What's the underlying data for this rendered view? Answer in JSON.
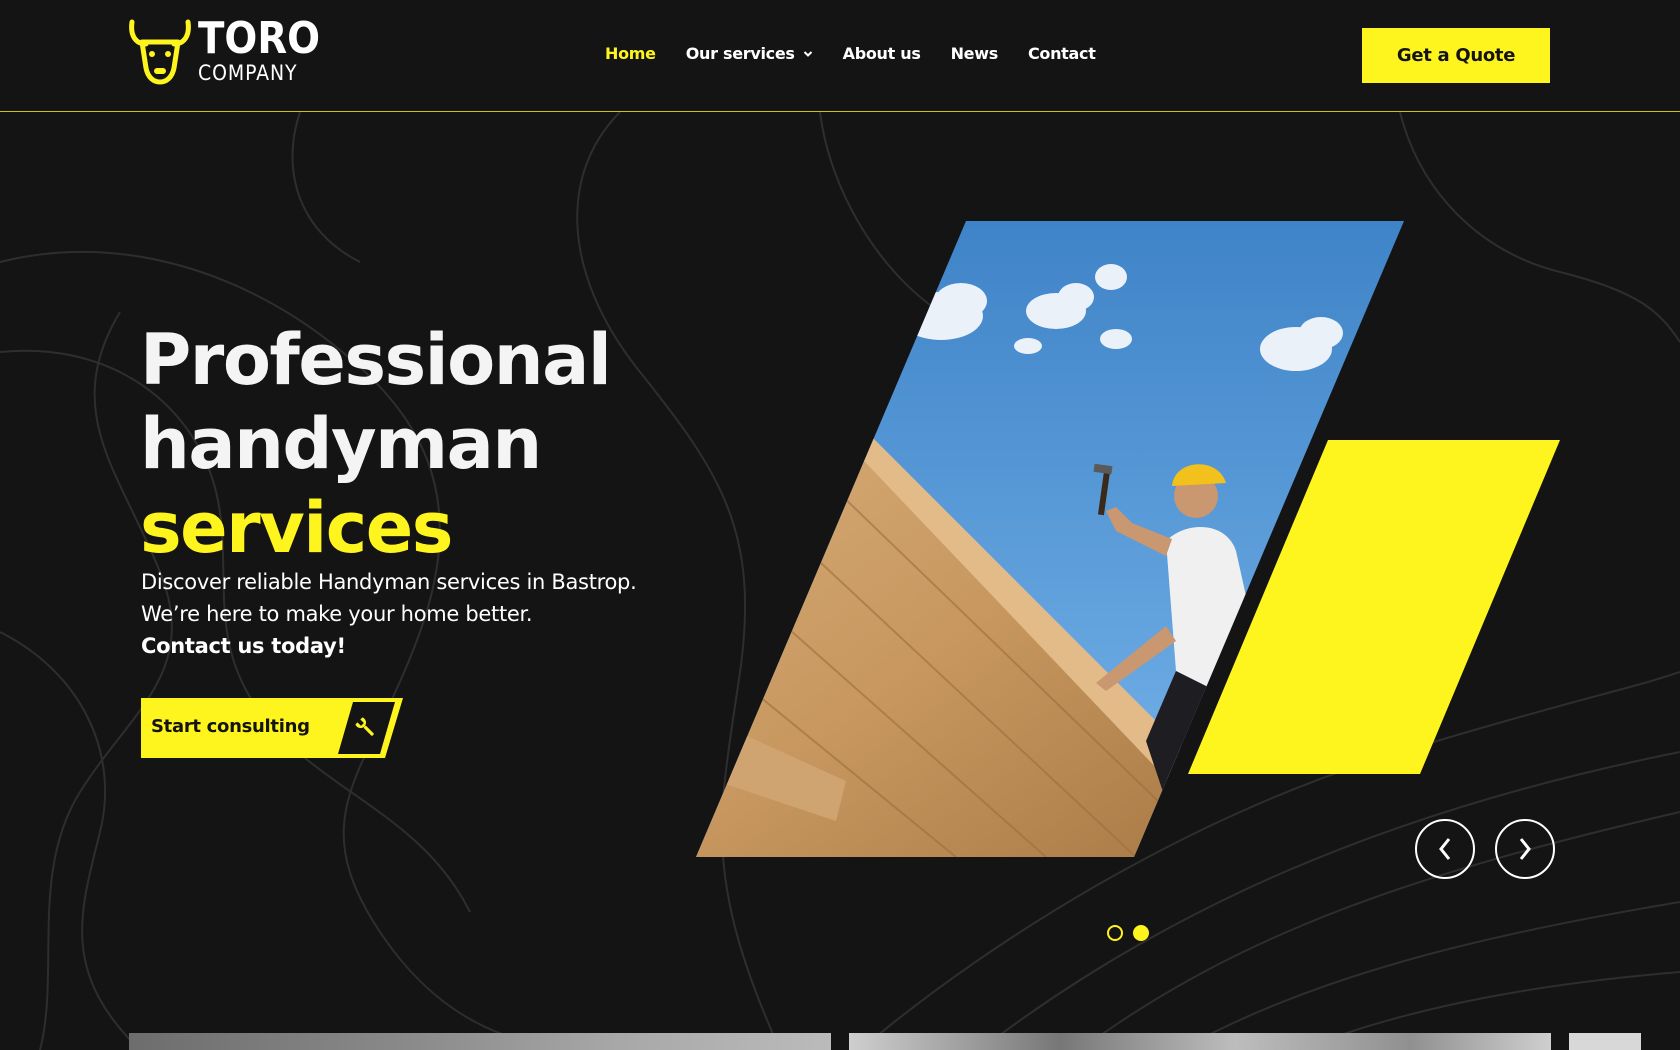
{
  "brand": {
    "name": "TORO",
    "tagline": "COMPANY",
    "icon": "bull-head-icon",
    "accent_color": "#fff51e",
    "background_color": "#141414"
  },
  "nav": {
    "items": [
      {
        "label": "Home",
        "active": true
      },
      {
        "label": "Our services",
        "has_dropdown": true,
        "icon": "chevron-down-icon"
      },
      {
        "label": "About us"
      },
      {
        "label": "News"
      },
      {
        "label": "Contact"
      }
    ]
  },
  "header": {
    "quote_button": "Get a Quote"
  },
  "hero": {
    "title_line1": "Professional",
    "title_line2": "handyman",
    "title_line3": "services",
    "subtitle_line1": "Discover reliable Handyman services in Bastrop.",
    "subtitle_line2": "We’re here to make your home better.",
    "subtitle_line3": "Contact us today!",
    "cta_label": "Start consulting",
    "cta_icon": "wrench-icon",
    "image_subject": "roofer-hammering-roof-photo"
  },
  "slider": {
    "prev_icon": "chevron-left-icon",
    "next_icon": "chevron-right-icon",
    "total_slides": 2,
    "active_slide": 2
  }
}
